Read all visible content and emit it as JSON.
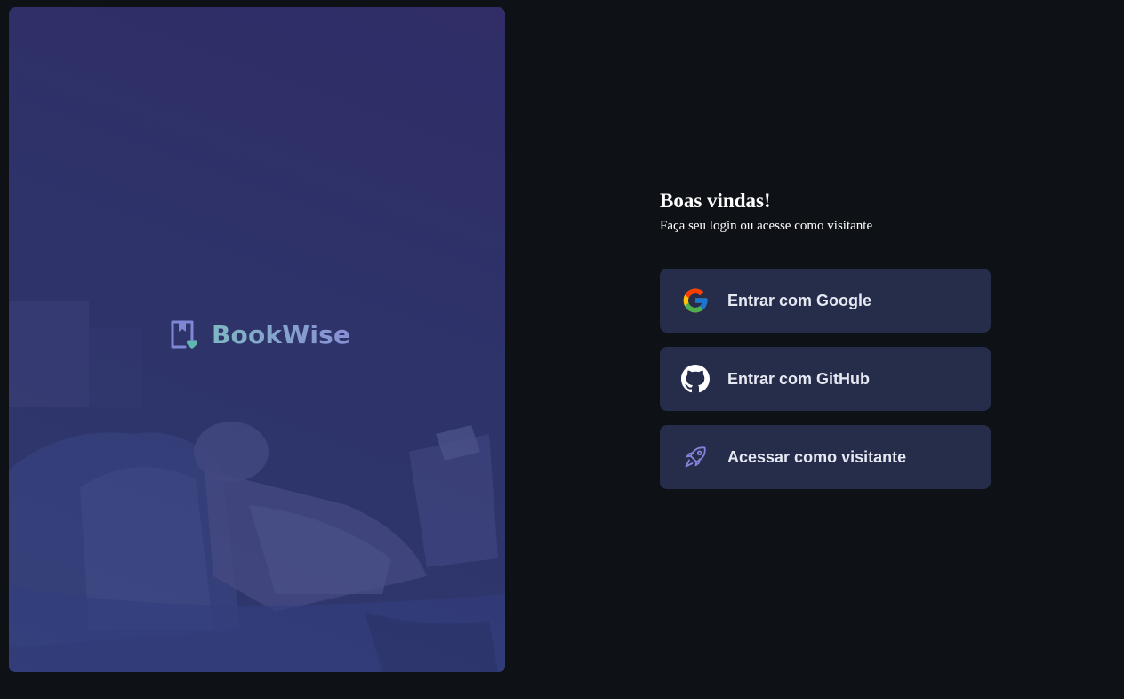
{
  "brand": {
    "name": "BookWise",
    "icon": "book-heart-icon"
  },
  "login": {
    "title": "Boas vindas!",
    "subtitle": "Faça seu login ou acesse como visitante",
    "buttons": [
      {
        "label": "Entrar com Google",
        "icon": "google-icon"
      },
      {
        "label": "Entrar com GitHub",
        "icon": "github-icon"
      },
      {
        "label": "Acessar como visitante",
        "icon": "rocket-icon"
      }
    ]
  },
  "colors": {
    "background": "#0e1116",
    "button_bg": "#252d4a",
    "button_text": "#e6e8f2",
    "brand_gradient_start": "#7fb7c2",
    "brand_gradient_end": "#8a8fd6"
  }
}
